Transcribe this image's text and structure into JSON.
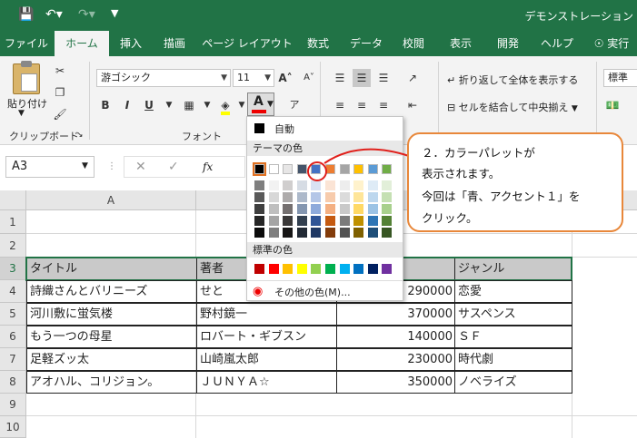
{
  "window": {
    "title": "デモンストレーション"
  },
  "quick_access": {
    "save_icon": "save-icon",
    "undo_icon": "undo-icon",
    "redo_icon": "redo-icon",
    "more_icon": "customize-icon"
  },
  "tabs": [
    "ファイル",
    "ホーム",
    "挿入",
    "描画",
    "ページ レイアウト",
    "数式",
    "データ",
    "校閲",
    "表示",
    "開発",
    "ヘルプ",
    "実行"
  ],
  "active_tab": "ホーム",
  "ribbon": {
    "clipboard": {
      "paste_label": "貼り付け",
      "group_label": "クリップボード"
    },
    "font": {
      "font_name": "游ゴシック",
      "font_size": "11",
      "bold": "B",
      "italic": "I",
      "underline": "U",
      "font_color_letter": "A",
      "group_label": "フォント"
    },
    "alignment": {
      "wrap_text": "折り返して全体を表示する",
      "merge_center": "セルを結合して中央揃え"
    },
    "number": {
      "format": "標準"
    }
  },
  "formula_bar": {
    "name_box": "A3",
    "fx": "fx"
  },
  "columns": [
    "A"
  ],
  "rows": [
    "1",
    "2",
    "3",
    "4",
    "5",
    "6",
    "7",
    "8",
    "9",
    "10"
  ],
  "table": {
    "header": [
      "タイトル",
      "著者",
      "",
      "ジャンル"
    ],
    "rows": [
      [
        "詩織さんとバリニーズ",
        "せと　",
        "290000",
        "恋愛"
      ],
      [
        "河川敷に蛍気楼",
        "野村鏡一",
        "370000",
        "サスペンス"
      ],
      [
        "もう一つの母星",
        "ロバート・ギブスン",
        "140000",
        "ＳＦ"
      ],
      [
        "足軽ズッ太",
        "山崎嵐太郎",
        "230000",
        "時代劇"
      ],
      [
        "アオハル、コリジョン。",
        "ＪＵＮＹＡ☆",
        "350000",
        "ノベライズ"
      ]
    ]
  },
  "palette": {
    "automatic": "自動",
    "theme_label": "テーマの色",
    "standard_label": "標準の色",
    "more_colors": "その他の色(M)...",
    "theme_colors": [
      "#000000",
      "#ffffff",
      "#e7e6e6",
      "#44546a",
      "#4472c4",
      "#ed7d31",
      "#a5a5a5",
      "#ffc000",
      "#5b9bd5",
      "#70ad47"
    ],
    "theme_shades": [
      [
        "#7f7f7f",
        "#f2f2f2",
        "#d0cece",
        "#d6dce4",
        "#d9e2f3",
        "#fbe4d5",
        "#ededed",
        "#fff2cc",
        "#deebf6",
        "#e2efd9"
      ],
      [
        "#595959",
        "#d8d8d8",
        "#aeabab",
        "#adb9ca",
        "#b4c6e7",
        "#f7cbac",
        "#dbdbdb",
        "#fee599",
        "#bdd7ee",
        "#c5e0b3"
      ],
      [
        "#3f3f3f",
        "#bfbfbf",
        "#757070",
        "#8496b0",
        "#8eaadb",
        "#f4b083",
        "#c9c9c9",
        "#ffd965",
        "#9cc3e5",
        "#a8d08d"
      ],
      [
        "#262626",
        "#a5a5a5",
        "#3a3838",
        "#323f4f",
        "#2f5496",
        "#c55a11",
        "#7b7b7b",
        "#bf9000",
        "#2e75b5",
        "#538135"
      ],
      [
        "#0c0c0c",
        "#7f7f7f",
        "#171616",
        "#222a35",
        "#1f3864",
        "#833c0b",
        "#525252",
        "#7f6000",
        "#1e4e79",
        "#375623"
      ]
    ],
    "standard_colors": [
      "#c00000",
      "#ff0000",
      "#ffc000",
      "#ffff00",
      "#92d050",
      "#00b050",
      "#00b0f0",
      "#0070c0",
      "#002060",
      "#7030a0"
    ]
  },
  "callout": {
    "lines": [
      "２．カラーパレットが",
      "表示されます。",
      "今回は「青、アクセント１」を",
      "クリック。"
    ],
    "border_color": "#e8873a",
    "highlight_color": "#e0201b"
  }
}
